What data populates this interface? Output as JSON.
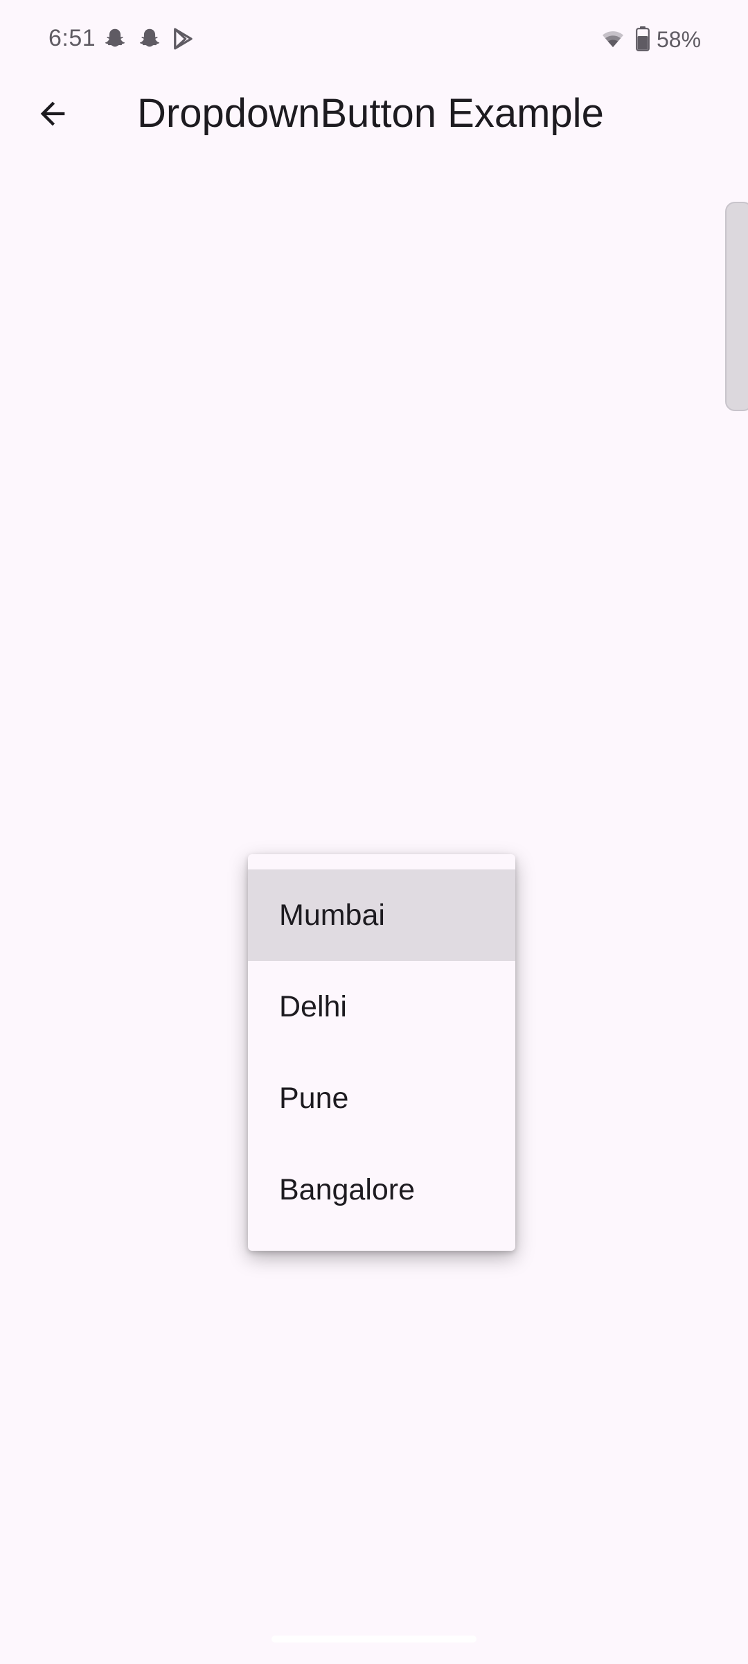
{
  "status_bar": {
    "time": "6:51",
    "notification_icons": [
      "snapchat-icon",
      "snapchat-icon",
      "play-store-icon"
    ],
    "wifi_icon": "wifi-icon",
    "battery_icon": "battery-icon",
    "battery_percent": "58%"
  },
  "app_bar": {
    "back_icon": "arrow-back-icon",
    "title": "DropdownButton Example"
  },
  "dropdown": {
    "selected_index": 0,
    "items": [
      {
        "label": "Mumbai"
      },
      {
        "label": "Delhi"
      },
      {
        "label": "Pune"
      },
      {
        "label": "Bangalore"
      }
    ]
  },
  "colors": {
    "background": "#fdf7fd",
    "menu_selected": "#e0dbe1",
    "text_primary": "#1d1b20",
    "status_text": "#5f5b63"
  }
}
